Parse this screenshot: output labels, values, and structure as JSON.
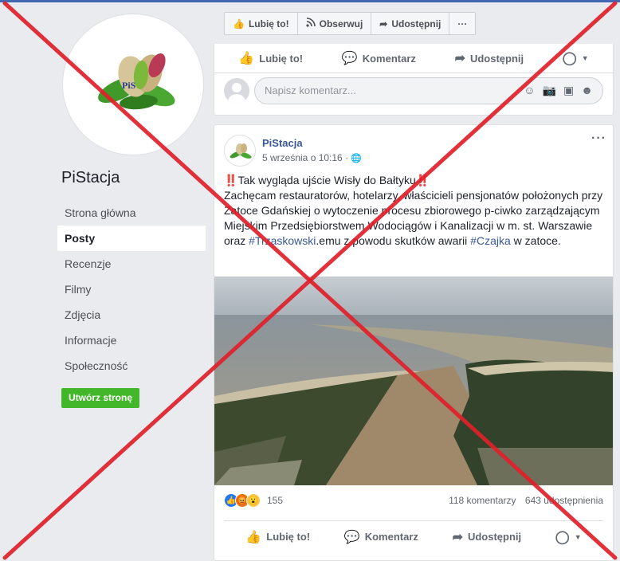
{
  "page": {
    "name": "PiStacja",
    "logo_text": "PiS"
  },
  "sidebar": {
    "items": [
      {
        "label": "Strona główna"
      },
      {
        "label": "Posty"
      },
      {
        "label": "Recenzje"
      },
      {
        "label": "Filmy"
      },
      {
        "label": "Zdjęcia"
      },
      {
        "label": "Informacje"
      },
      {
        "label": "Społeczność"
      }
    ],
    "active": "Posty",
    "create_page_label": "Utwórz stronę"
  },
  "actionbar": {
    "like_label": "Lubię to!",
    "follow_label": "Obserwuj",
    "share_label": "Udostępnij",
    "more_label": "···"
  },
  "reactions": {
    "like_label": "Lubię to!",
    "comment_label": "Komentarz",
    "share_label": "Udostępnij"
  },
  "comment_box": {
    "placeholder": "Napisz komentarz..."
  },
  "post": {
    "author": "PiStacja",
    "time": "5 września o 10:16 ·",
    "headline_prefix": "‼️",
    "headline": "Tak wygląda ujście Wisły do Bałtyku",
    "headline_suffix": "‼️",
    "body_1": "Zachęcam restauratorów, hotelarzy, właścicieli pensjonatów położonych przy Zatoce Gdańskiej o wytoczenie procesu zbiorowego p-ciwko zarządzającym Miejskim Przedsiębiorstwem Wodociągów i Kanalizacji w m. st. Warszawie oraz ",
    "tag_1": "#Trzaskowski",
    "body_2": ".emu z powodu skutków awarii ",
    "tag_2": "#Czajka",
    "body_3": " w zatoce.",
    "reaction_count": "155",
    "comments_count": "118 komentarzy",
    "shares_count": "643 udostępnienia"
  },
  "colors": {
    "brand_blue": "#4267b2",
    "link": "#385898",
    "green": "#42b72a",
    "cross_red": "#e0202a"
  }
}
